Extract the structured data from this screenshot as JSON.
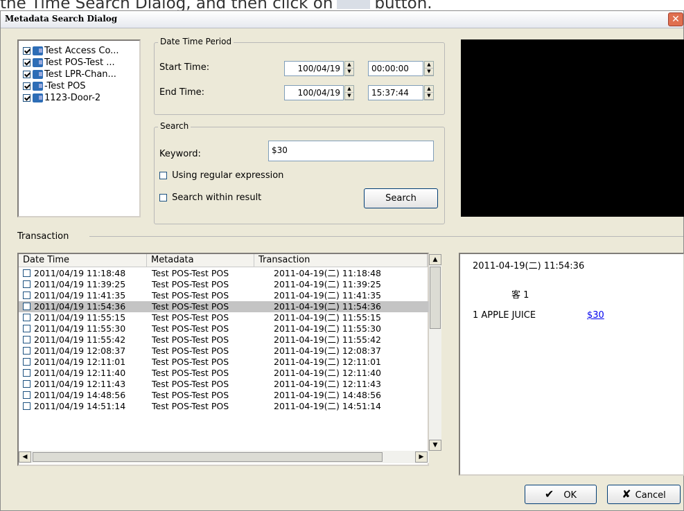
{
  "overlay_text": {
    "before": "the Time Search Dialog, and then click on",
    "after": "button."
  },
  "window": {
    "title": "Metadata Search Dialog",
    "close_glyph": "✕"
  },
  "device_tree": {
    "items": [
      {
        "label": "Test Access Co...",
        "checked": true
      },
      {
        "label": "Test POS-Test ...",
        "checked": true
      },
      {
        "label": "Test LPR-Chan...",
        "checked": true
      },
      {
        "label": "-Test POS",
        "checked": true
      },
      {
        "label": "1123-Door-2",
        "checked": true
      }
    ]
  },
  "date_time_period": {
    "title": "Date Time Period",
    "start_label": "Start Time:",
    "start_date": "100/04/19",
    "start_time": "00:00:00",
    "end_label": "End Time:",
    "end_date": "100/04/19",
    "end_time": "15:37:44"
  },
  "search": {
    "title": "Search",
    "keyword_label": "Keyword:",
    "keyword_value": "$30",
    "regex_label": "Using regular expression",
    "within_label": "Search within result",
    "search_button": "Search"
  },
  "transaction": {
    "section_label": "Transaction",
    "columns": [
      "Date Time",
      "Metadata",
      "Transaction"
    ],
    "selected_index": 3,
    "rows": [
      {
        "datetime": "2011/04/19 11:18:48",
        "metadata": "Test POS-Test POS",
        "transaction": "2011-04-19(二)  11:18:48"
      },
      {
        "datetime": "2011/04/19 11:39:25",
        "metadata": "Test POS-Test POS",
        "transaction": "2011-04-19(二)  11:39:25"
      },
      {
        "datetime": "2011/04/19 11:41:35",
        "metadata": "Test POS-Test POS",
        "transaction": "2011-04-19(二)  11:41:35"
      },
      {
        "datetime": "2011/04/19 11:54:36",
        "metadata": "Test POS-Test POS",
        "transaction": "2011-04-19(二)  11:54:36"
      },
      {
        "datetime": "2011/04/19 11:55:15",
        "metadata": "Test POS-Test POS",
        "transaction": "2011-04-19(二)  11:55:15"
      },
      {
        "datetime": "2011/04/19 11:55:30",
        "metadata": "Test POS-Test POS",
        "transaction": "2011-04-19(二)  11:55:30"
      },
      {
        "datetime": "2011/04/19 11:55:42",
        "metadata": "Test POS-Test POS",
        "transaction": "2011-04-19(二)  11:55:42"
      },
      {
        "datetime": "2011/04/19 12:08:37",
        "metadata": "Test POS-Test POS",
        "transaction": "2011-04-19(二)  12:08:37"
      },
      {
        "datetime": "2011/04/19 12:11:01",
        "metadata": "Test POS-Test POS",
        "transaction": "2011-04-19(二)  12:11:01"
      },
      {
        "datetime": "2011/04/19 12:11:40",
        "metadata": "Test POS-Test POS",
        "transaction": "2011-04-19(二)  12:11:40"
      },
      {
        "datetime": "2011/04/19 12:11:43",
        "metadata": "Test POS-Test POS",
        "transaction": "2011-04-19(二)  12:11:43"
      },
      {
        "datetime": "2011/04/19 14:48:56",
        "metadata": "Test POS-Test POS",
        "transaction": "2011-04-19(二)  14:48:56"
      },
      {
        "datetime": "2011/04/19 14:51:14",
        "metadata": "Test POS-Test POS",
        "transaction": "2011-04-19(二)  14:51:14"
      }
    ]
  },
  "detail": {
    "timestamp": "2011-04-19(二)  11:54:36",
    "customer": "客 1",
    "item": "1  APPLE JUICE",
    "amount": "$30"
  },
  "buttons": {
    "ok": "OK",
    "ok_icon": "✔",
    "cancel": "Cancel",
    "cancel_icon": "✘"
  },
  "colors": {
    "selection": "#c4c4c4",
    "preview": "#000000",
    "link": "#0000ee",
    "close": "#e07050"
  }
}
